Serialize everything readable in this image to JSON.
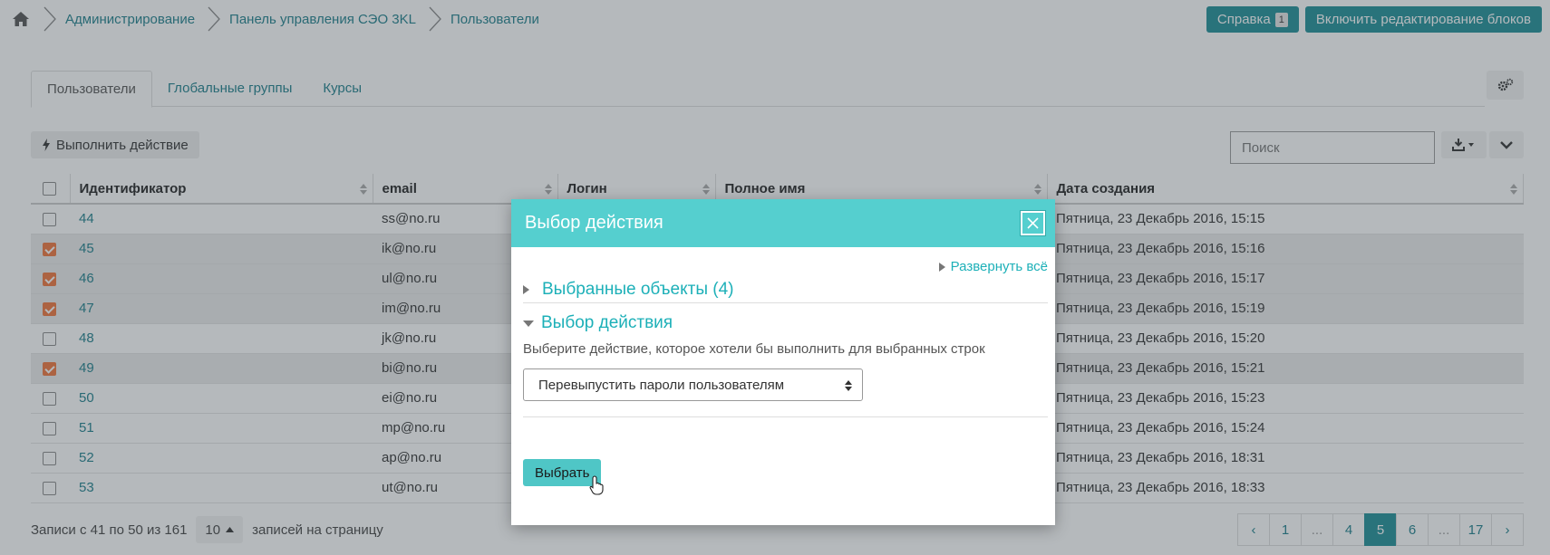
{
  "breadcrumb": {
    "items": [
      "Администрирование",
      "Панель управления СЭО 3KL",
      "Пользователи"
    ]
  },
  "header": {
    "help_label": "Справка",
    "help_badge": "1",
    "edit_blocks_label": "Включить редактирование блоков"
  },
  "tabs": [
    "Пользователи",
    "Глобальные группы",
    "Курсы"
  ],
  "toolbar": {
    "action_label": "Выполнить действие",
    "search_placeholder": "Поиск"
  },
  "table": {
    "headers": [
      "Идентификатор",
      "email",
      "Логин",
      "Полное имя",
      "Дата создания"
    ],
    "rows": [
      {
        "id": "44",
        "email": "ss@no.ru",
        "date": "Пятница, 23 Декабрь 2016, 15:15",
        "checked": false
      },
      {
        "id": "45",
        "email": "ik@no.ru",
        "date": "Пятница, 23 Декабрь 2016, 15:16",
        "checked": true
      },
      {
        "id": "46",
        "email": "ul@no.ru",
        "date": "Пятница, 23 Декабрь 2016, 15:17",
        "checked": true
      },
      {
        "id": "47",
        "email": "im@no.ru",
        "date": "Пятница, 23 Декабрь 2016, 15:19",
        "checked": true
      },
      {
        "id": "48",
        "email": "jk@no.ru",
        "date": "Пятница, 23 Декабрь 2016, 15:20",
        "checked": false
      },
      {
        "id": "49",
        "email": "bi@no.ru",
        "date": "Пятница, 23 Декабрь 2016, 15:21",
        "checked": true
      },
      {
        "id": "50",
        "email": "ei@no.ru",
        "date": "Пятница, 23 Декабрь 2016, 15:23",
        "checked": false
      },
      {
        "id": "51",
        "email": "mp@no.ru",
        "date": "Пятница, 23 Декабрь 2016, 15:24",
        "checked": false
      },
      {
        "id": "52",
        "email": "ap@no.ru",
        "date": "Пятница, 23 Декабрь 2016, 18:31",
        "checked": false
      },
      {
        "id": "53",
        "email": "ut@no.ru",
        "date": "Пятница, 23 Декабрь 2016, 18:33",
        "checked": false
      }
    ]
  },
  "footer": {
    "records_text": "Записи с 41 по 50 из 161",
    "per_page_value": "10",
    "per_page_suffix": "записей на страницу",
    "pages": [
      "‹",
      "1",
      "...",
      "4",
      "5",
      "6",
      "...",
      "17",
      "›"
    ],
    "active_page": "5"
  },
  "modal": {
    "title": "Выбор действия",
    "expand_all": "Развернуть всё",
    "section_selected": "Выбранные объекты (4)",
    "section_action": "Выбор действия",
    "hint": "Выберите действие, которое хотели бы выполнить для выбранных строк",
    "select_value": "Перевыпустить пароли пользователям",
    "choose_button": "Выбрать"
  },
  "colors": {
    "accent": "#1e8e96",
    "modal_header": "#55cfcf",
    "checkbox_on": "#f0753b"
  }
}
